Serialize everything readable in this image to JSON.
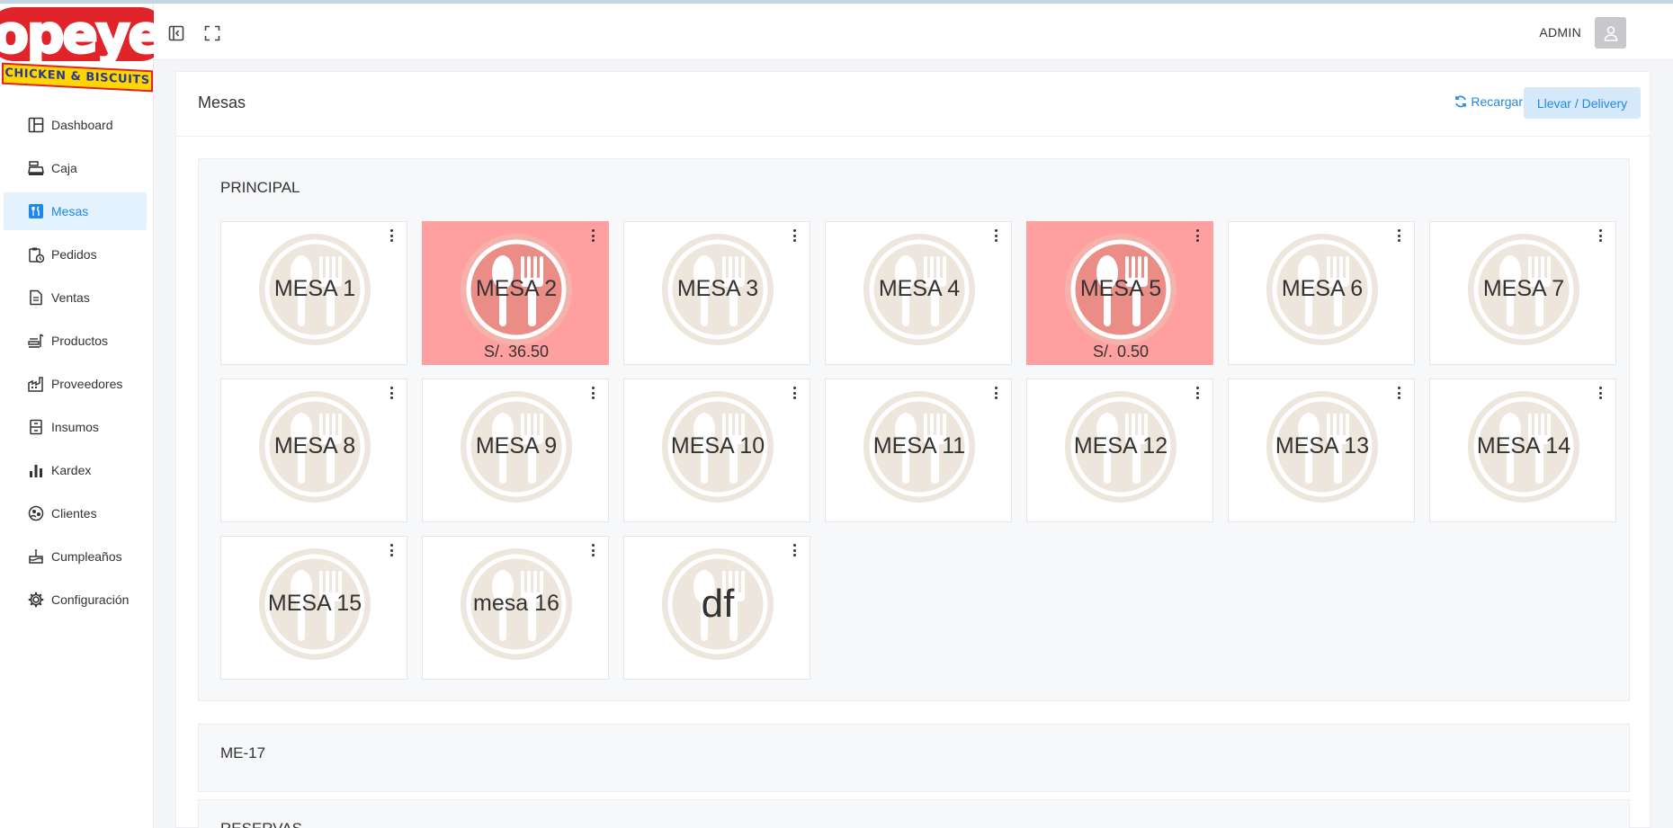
{
  "brand": {
    "logo_word": "Popeyes",
    "logo_tagline": "CHICKEN & BISCUITS"
  },
  "sidebar": {
    "items": [
      {
        "label": "Dashboard",
        "icon": "dashboard-icon"
      },
      {
        "label": "Caja",
        "icon": "cash-register-icon"
      },
      {
        "label": "Mesas",
        "icon": "utensils-icon",
        "active": true
      },
      {
        "label": "Pedidos",
        "icon": "clipboard-clock-icon"
      },
      {
        "label": "Ventas",
        "icon": "document-icon"
      },
      {
        "label": "Productos",
        "icon": "products-icon"
      },
      {
        "label": "Proveedores",
        "icon": "factory-icon"
      },
      {
        "label": "Insumos",
        "icon": "cabinet-icon"
      },
      {
        "label": "Kardex",
        "icon": "bar-chart-icon"
      },
      {
        "label": "Clientes",
        "icon": "clients-icon"
      },
      {
        "label": "Cumpleaños",
        "icon": "cake-icon"
      },
      {
        "label": "Configuración",
        "icon": "gear-icon"
      }
    ]
  },
  "topbar": {
    "user": "ADMIN"
  },
  "main": {
    "title": "Mesas",
    "reload_label": "Recargar",
    "delivery_label": "Llevar / Delivery",
    "sections": [
      {
        "title": "PRINCIPAL",
        "tables": [
          {
            "name": "MESA 1",
            "busy": false,
            "amount": ""
          },
          {
            "name": "MESA 2",
            "busy": true,
            "amount": "S/. 36.50"
          },
          {
            "name": "MESA 3",
            "busy": false,
            "amount": ""
          },
          {
            "name": "MESA 4",
            "busy": false,
            "amount": ""
          },
          {
            "name": "MESA 5",
            "busy": true,
            "amount": "S/. 0.50"
          },
          {
            "name": "MESA 6",
            "busy": false,
            "amount": ""
          },
          {
            "name": "MESA 7",
            "busy": false,
            "amount": ""
          },
          {
            "name": "MESA 8",
            "busy": false,
            "amount": ""
          },
          {
            "name": "MESA 9",
            "busy": false,
            "amount": ""
          },
          {
            "name": "MESA 10",
            "busy": false,
            "amount": ""
          },
          {
            "name": "MESA 11",
            "busy": false,
            "amount": ""
          },
          {
            "name": "MESA 12",
            "busy": false,
            "amount": ""
          },
          {
            "name": "MESA 13",
            "busy": false,
            "amount": ""
          },
          {
            "name": "MESA 14",
            "busy": false,
            "amount": ""
          },
          {
            "name": "MESA 15",
            "busy": false,
            "amount": ""
          },
          {
            "name": "mesa 16",
            "busy": false,
            "amount": ""
          },
          {
            "name": "df",
            "busy": false,
            "amount": "",
            "big": true
          }
        ]
      },
      {
        "title": "ME-17",
        "tables": []
      },
      {
        "title": "RESERVAS",
        "tables": []
      }
    ]
  },
  "colors": {
    "accent": "#1e88e5",
    "active_bg": "#e3f2fd",
    "busy_table": "#ff9f9f",
    "emblem": "#ede6dc"
  }
}
